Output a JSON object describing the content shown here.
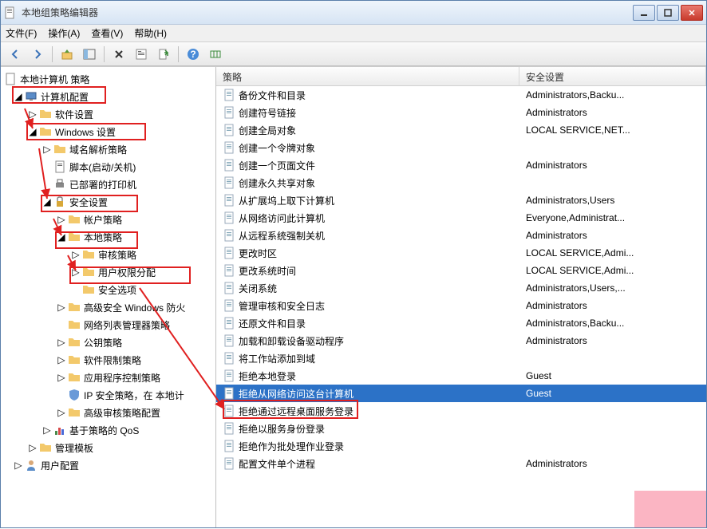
{
  "window": {
    "title": "本地组策略编辑器"
  },
  "menu": {
    "file": "文件(F)",
    "action": "操作(A)",
    "view": "查看(V)",
    "help": "帮助(H)"
  },
  "tree": {
    "root": "本地计算机 策略",
    "computer_config": "计算机配置",
    "software_settings": "软件设置",
    "windows_settings": "Windows 设置",
    "dns_policy": "域名解析策略",
    "scripts": "脚本(启动/关机)",
    "deployed_printers": "已部署的打印机",
    "security_settings": "安全设置",
    "account_policies": "帐户策略",
    "local_policies": "本地策略",
    "audit_policy": "审核策略",
    "user_rights": "用户权限分配",
    "security_options": "安全选项",
    "advanced_firewall": "高级安全 Windows 防火",
    "network_list": "网络列表管理器策略",
    "public_key": "公钥策略",
    "software_restrict": "软件限制策略",
    "app_control": "应用程序控制策略",
    "ip_security": "IP 安全策略，在 本地计",
    "advanced_audit": "高级审核策略配置",
    "qos": "基于策略的 QoS",
    "admin_templates": "管理模板",
    "user_config": "用户配置"
  },
  "columns": {
    "policy": "策略",
    "setting": "安全设置"
  },
  "policies": [
    {
      "name": "备份文件和目录",
      "setting": "Administrators,Backu..."
    },
    {
      "name": "创建符号链接",
      "setting": "Administrators"
    },
    {
      "name": "创建全局对象",
      "setting": "LOCAL SERVICE,NET..."
    },
    {
      "name": "创建一个令牌对象",
      "setting": ""
    },
    {
      "name": "创建一个页面文件",
      "setting": "Administrators"
    },
    {
      "name": "创建永久共享对象",
      "setting": ""
    },
    {
      "name": "从扩展坞上取下计算机",
      "setting": "Administrators,Users"
    },
    {
      "name": "从网络访问此计算机",
      "setting": "Everyone,Administrat..."
    },
    {
      "name": "从远程系统强制关机",
      "setting": "Administrators"
    },
    {
      "name": "更改时区",
      "setting": "LOCAL SERVICE,Admi..."
    },
    {
      "name": "更改系统时间",
      "setting": "LOCAL SERVICE,Admi..."
    },
    {
      "name": "关闭系统",
      "setting": "Administrators,Users,..."
    },
    {
      "name": "管理审核和安全日志",
      "setting": "Administrators"
    },
    {
      "name": "还原文件和目录",
      "setting": "Administrators,Backu..."
    },
    {
      "name": "加载和卸载设备驱动程序",
      "setting": "Administrators"
    },
    {
      "name": "将工作站添加到域",
      "setting": ""
    },
    {
      "name": "拒绝本地登录",
      "setting": "Guest"
    },
    {
      "name": "拒绝从网络访问这台计算机",
      "setting": "Guest",
      "selected": true
    },
    {
      "name": "拒绝通过远程桌面服务登录",
      "setting": ""
    },
    {
      "name": "拒绝以服务身份登录",
      "setting": ""
    },
    {
      "name": "拒绝作为批处理作业登录",
      "setting": ""
    },
    {
      "name": "配置文件单个进程",
      "setting": "Administrators"
    }
  ]
}
